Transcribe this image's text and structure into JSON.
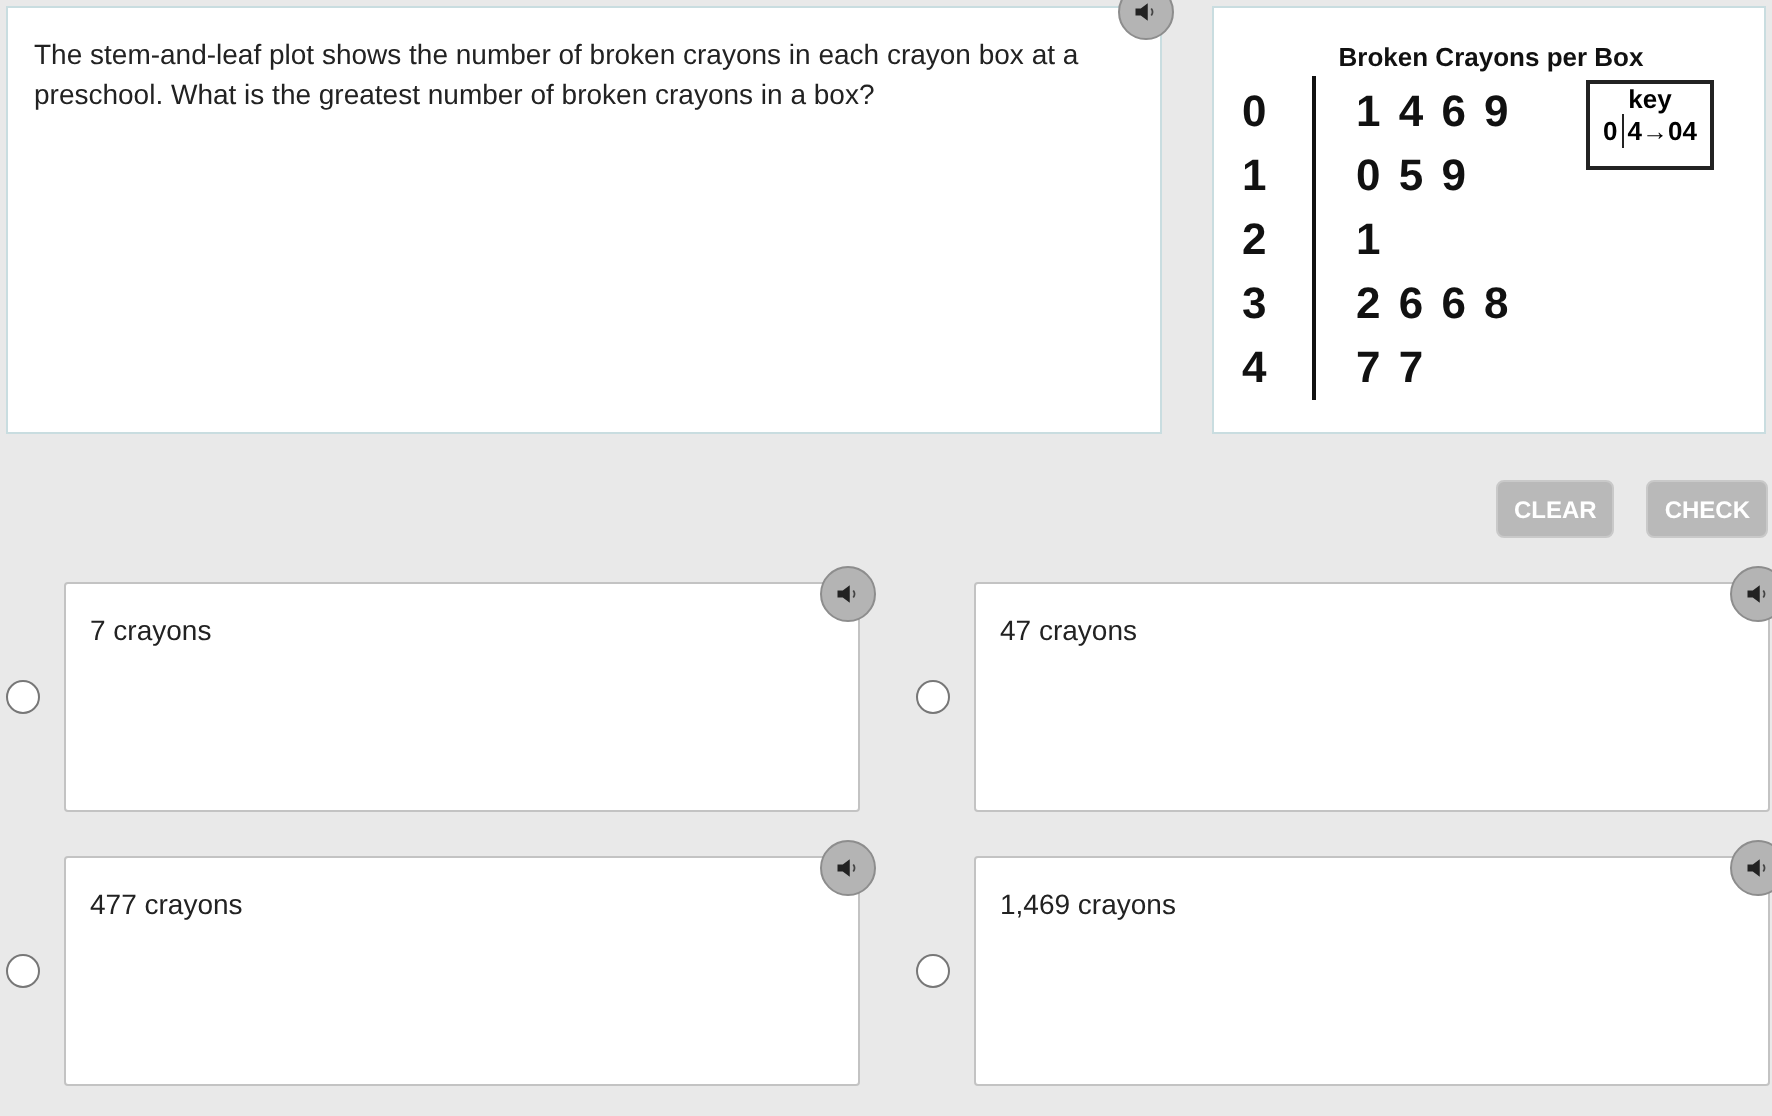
{
  "question": {
    "text": "The stem-and-leaf plot shows the number of broken crayons in each crayon box at a preschool. What is the greatest number of broken crayons in a box?"
  },
  "plot": {
    "title": "Broken Crayons per Box",
    "rows": [
      {
        "stem": "0",
        "leaves": "1 4 6 9"
      },
      {
        "stem": "1",
        "leaves": "0 5 9"
      },
      {
        "stem": "2",
        "leaves": "1"
      },
      {
        "stem": "3",
        "leaves": "2 6 6 8"
      },
      {
        "stem": "4",
        "leaves": "7 7"
      }
    ],
    "key": {
      "title": "key",
      "stem": "0",
      "leaf": "4→04"
    }
  },
  "buttons": [
    {
      "label": "CLEAR",
      "disabled": true
    },
    {
      "label": "CHECK",
      "disabled": true
    }
  ],
  "options": [
    {
      "text": "7 crayons",
      "selected": false
    },
    {
      "text": "47 crayons",
      "selected": false
    },
    {
      "text": "477 crayons",
      "selected": false
    },
    {
      "text": "1,469 crayons",
      "selected": false
    }
  ]
}
